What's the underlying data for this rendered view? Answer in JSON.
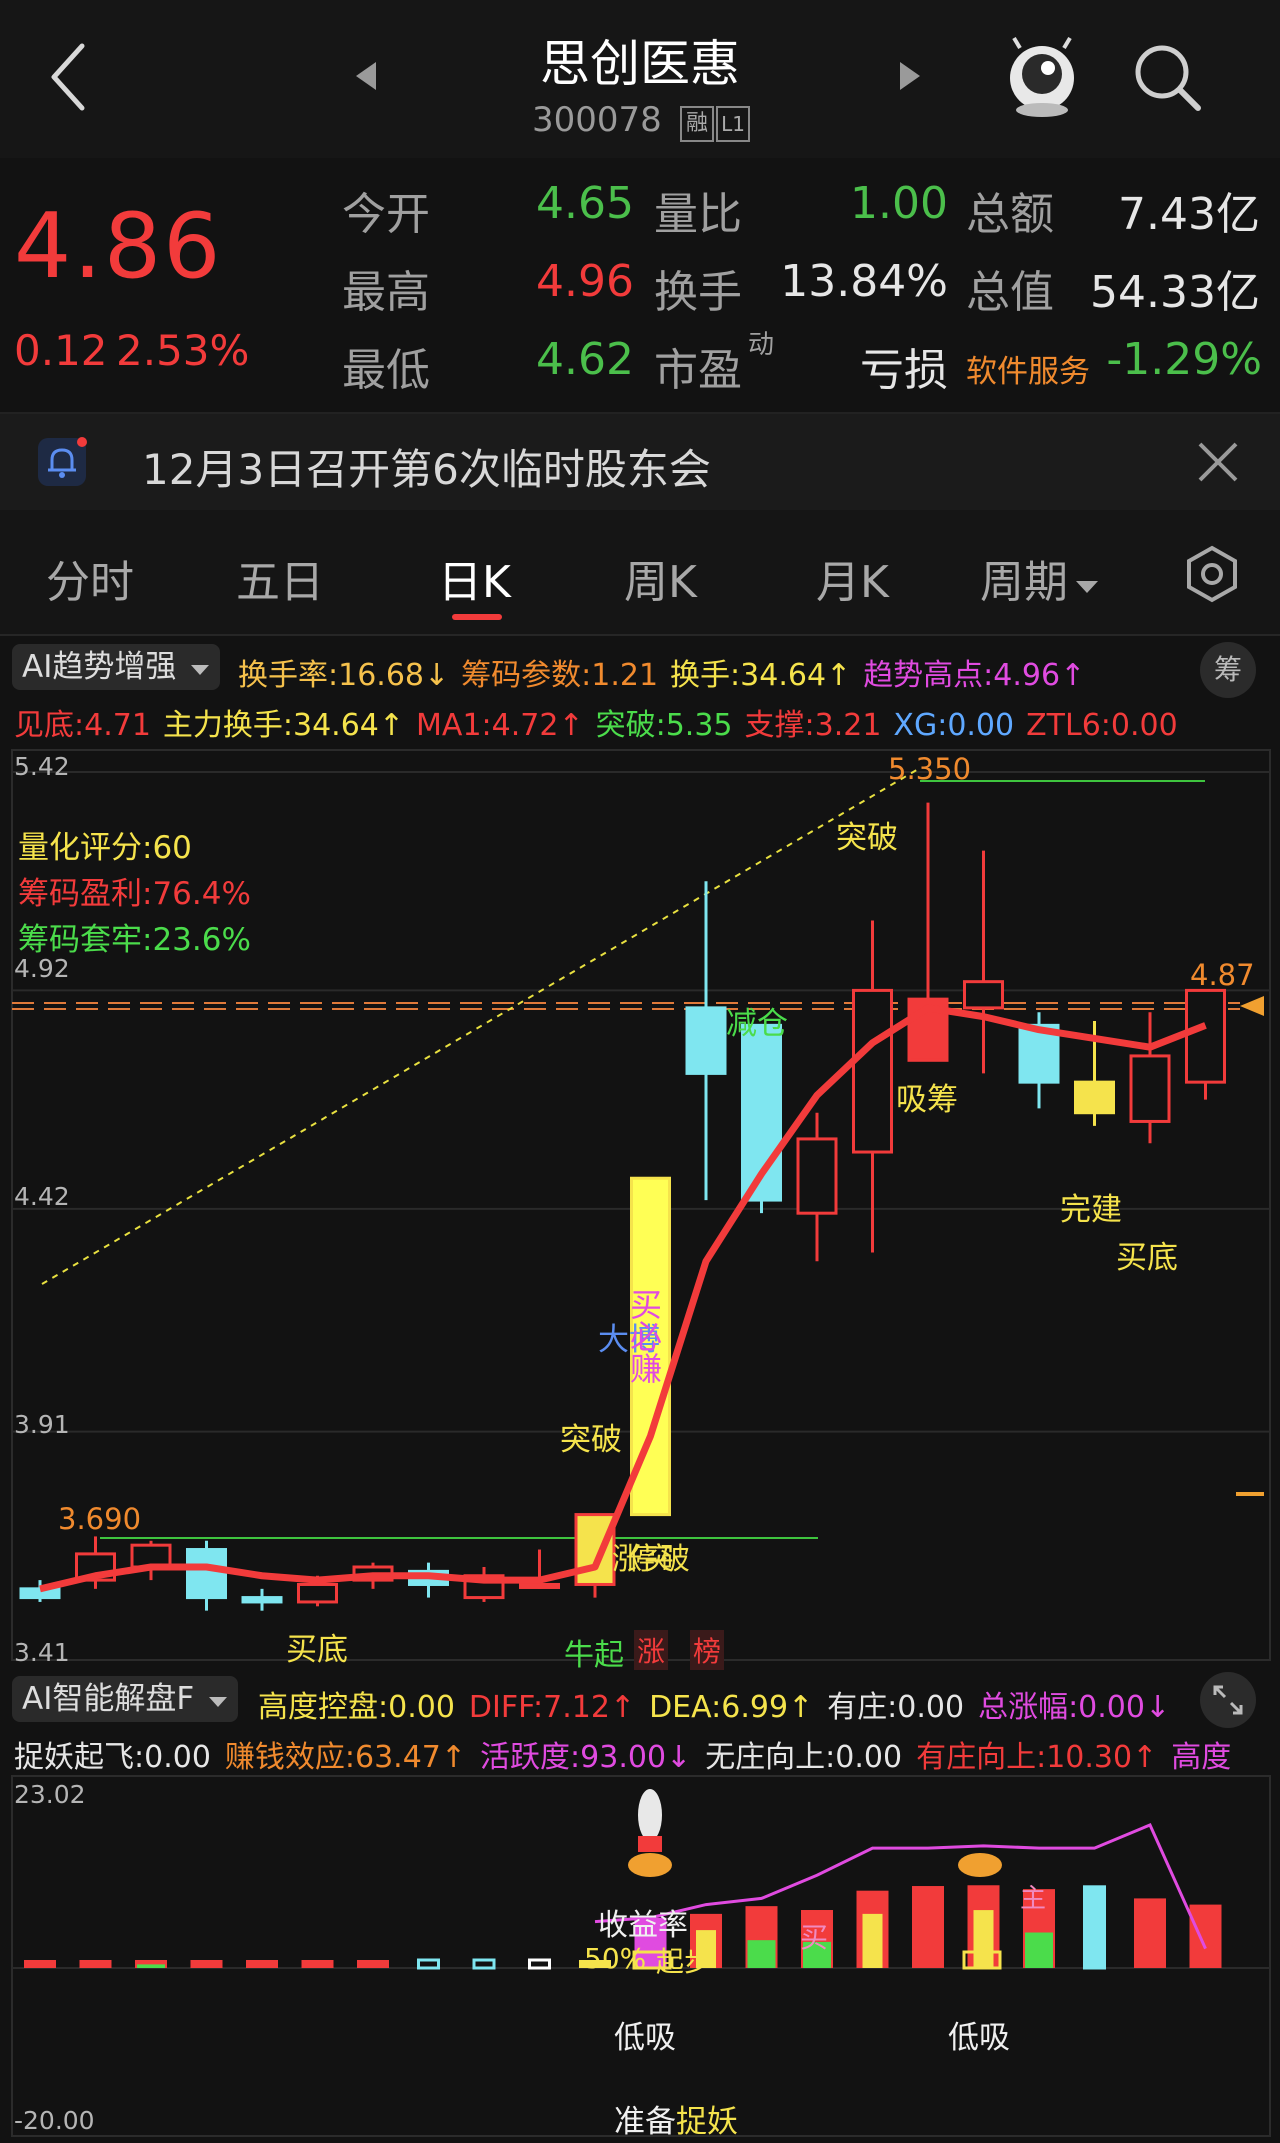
{
  "header": {
    "title": "思创医惠",
    "code": "300078",
    "badge_rong": "融",
    "badge_level": "L1"
  },
  "quote": {
    "price": "4.86",
    "change": "0.12",
    "change_pct": "2.53%",
    "open_label": "今开",
    "open": "4.65",
    "high_label": "最高",
    "high": "4.96",
    "low_label": "最低",
    "low": "4.62",
    "vol_ratio_label": "量比",
    "vol_ratio": "1.00",
    "turnover_label": "换手",
    "turnover": "13.84%",
    "pe_label": "市盈",
    "pe_sup": "动",
    "pe": "亏损",
    "amount_label": "总额",
    "amount": "7.43亿",
    "mcap_label": "总值",
    "mcap": "54.33亿",
    "sector_label": "软件服务",
    "sector_change": "-1.29%"
  },
  "notice": {
    "text": "12月3日召开第6次临时股东会"
  },
  "tabs": [
    "分时",
    "五日",
    "日K",
    "周K",
    "月K",
    "周期"
  ],
  "main_indicator": {
    "name": "AI趋势增强",
    "row1": [
      {
        "text": "换手率:16.68↓",
        "color": "#f5c14c"
      },
      {
        "text": "筹码参数:1.21",
        "color": "#f08a2e"
      },
      {
        "text": "换手:34.64↑",
        "color": "#f5e34c"
      },
      {
        "text": "趋势高点:4.96↑",
        "color": "#e04be0"
      }
    ],
    "row2": [
      {
        "text": "见底:4.71",
        "color": "#f23b3b"
      },
      {
        "text": "主力换手:34.64↑",
        "color": "#f5e34c"
      },
      {
        "text": "MA1:4.72↑",
        "color": "#f23b3b"
      },
      {
        "text": "突破:5.35",
        "color": "#4bdc4b"
      },
      {
        "text": "支撑:3.21",
        "color": "#f23b3b"
      },
      {
        "text": "XG:0.00",
        "color": "#5fa8ff"
      },
      {
        "text": "ZTL6:0.00",
        "color": "#f23b3b"
      }
    ],
    "chip_button": "筹"
  },
  "kchart": {
    "y_ticks": [
      "5.42",
      "4.92",
      "4.42",
      "3.91",
      "3.41"
    ],
    "score": "量化评分:60",
    "profit": "筹码盈利:76.4%",
    "trapped": "筹码套牢:23.6%",
    "high_label": "5.350",
    "low_label": "3.690",
    "last_label": "4.87",
    "annotations": {
      "tupo_top": "突破",
      "jiancang": "减仓",
      "xichou": "吸筹",
      "wanjian": "完建",
      "maidi_right": "买底",
      "maidi_left": "买底",
      "dabo": "大博",
      "buy1": "买",
      "buy2": "必",
      "buy3": "赚",
      "tupo_left": "突破",
      "overlap": "涨停突破",
      "niuqi": "牛起",
      "zhang": "涨",
      "bang": "榜"
    }
  },
  "sub_indicator": {
    "name": "AI智能解盘F",
    "row1": [
      {
        "text": "高度控盘:0.00",
        "color": "#f5e34c"
      },
      {
        "text": "DIFF:7.12↑",
        "color": "#f23b3b"
      },
      {
        "text": "DEA:6.99↑",
        "color": "#f5e34c"
      },
      {
        "text": "有庄:0.00",
        "color": "#e6e6e6"
      },
      {
        "text": "总涨幅:0.00↓",
        "color": "#e04be0"
      }
    ],
    "row2": [
      {
        "text": "捉妖起飞:0.00",
        "color": "#e6e6e6"
      },
      {
        "text": "赚钱效应:63.47↑",
        "color": "#f08a2e"
      },
      {
        "text": "活跃度:93.00↓",
        "color": "#e04be0"
      },
      {
        "text": "无庄向上:0.00",
        "color": "#e6e6e6"
      },
      {
        "text": "有庄向上:10.30↑",
        "color": "#f23b3b"
      },
      {
        "text": "高度",
        "color": "#e04be0"
      }
    ],
    "y_max": "23.02",
    "y_min": "-20.00",
    "labels": {
      "shouyi": "收益率",
      "pct": "50%",
      "qibu": "起步",
      "dixi1": "低吸",
      "dixi2": "低吸",
      "zhunbei": "准备",
      "zhuoyao": "捉妖",
      "mai": "买",
      "zhu": "主"
    }
  },
  "chart_data": {
    "type": "candlestick",
    "price_axis": {
      "min": 3.41,
      "max": 5.42
    },
    "candles": [
      {
        "o": 3.55,
        "h": 3.57,
        "l": 3.52,
        "c": 3.53
      },
      {
        "o": 3.57,
        "h": 3.67,
        "l": 3.55,
        "c": 3.63
      },
      {
        "o": 3.6,
        "h": 3.66,
        "l": 3.57,
        "c": 3.65
      },
      {
        "o": 3.64,
        "h": 3.66,
        "l": 3.5,
        "c": 3.53
      },
      {
        "o": 3.53,
        "h": 3.55,
        "l": 3.5,
        "c": 3.52
      },
      {
        "o": 3.52,
        "h": 3.58,
        "l": 3.51,
        "c": 3.56
      },
      {
        "o": 3.57,
        "h": 3.61,
        "l": 3.55,
        "c": 3.6
      },
      {
        "o": 3.59,
        "h": 3.61,
        "l": 3.53,
        "c": 3.56
      },
      {
        "o": 3.53,
        "h": 3.6,
        "l": 3.52,
        "c": 3.58
      },
      {
        "o": 3.56,
        "h": 3.64,
        "l": 3.55,
        "c": 3.56
      },
      {
        "o": 3.56,
        "h": 3.72,
        "l": 3.53,
        "c": 3.72
      },
      {
        "o": 3.72,
        "h": 4.49,
        "l": 3.72,
        "c": 4.49
      },
      {
        "o": 4.88,
        "h": 5.17,
        "l": 4.44,
        "c": 4.73
      },
      {
        "o": 4.84,
        "h": 4.84,
        "l": 4.41,
        "c": 4.44
      },
      {
        "o": 4.41,
        "h": 4.64,
        "l": 4.3,
        "c": 4.58
      },
      {
        "o": 4.55,
        "h": 5.08,
        "l": 4.32,
        "c": 4.92
      },
      {
        "o": 4.76,
        "h": 5.35,
        "l": 4.76,
        "c": 4.9
      },
      {
        "o": 4.88,
        "h": 5.24,
        "l": 4.73,
        "c": 4.94
      },
      {
        "o": 4.84,
        "h": 4.87,
        "l": 4.65,
        "c": 4.71
      },
      {
        "o": 4.71,
        "h": 4.85,
        "l": 4.61,
        "c": 4.64
      },
      {
        "o": 4.62,
        "h": 4.87,
        "l": 4.57,
        "c": 4.77
      },
      {
        "o": 4.71,
        "h": 4.92,
        "l": 4.67,
        "c": 4.92
      }
    ],
    "ma_line": [
      3.55,
      3.58,
      3.6,
      3.6,
      3.58,
      3.57,
      3.58,
      3.58,
      3.57,
      3.57,
      3.6,
      3.9,
      4.3,
      4.5,
      4.68,
      4.8,
      4.88,
      4.86,
      4.83,
      4.81,
      4.79,
      4.84
    ],
    "sub_bars": [
      {
        "v": 0.5,
        "type": "red"
      },
      {
        "v": 0.6,
        "type": "red"
      },
      {
        "v": 0.8,
        "type": "redgreen"
      },
      {
        "v": 0.6,
        "type": "red"
      },
      {
        "v": 0.5,
        "type": "red"
      },
      {
        "v": 0.6,
        "type": "red"
      },
      {
        "v": 0.5,
        "type": "red"
      },
      {
        "v": 0.5,
        "type": "cyan"
      },
      {
        "v": 0.5,
        "type": "cyan"
      },
      {
        "v": 0.3,
        "type": "white"
      },
      {
        "v": 0.4,
        "type": "yellow"
      },
      {
        "v": 6.5,
        "type": "magenta"
      },
      {
        "v": 7.0,
        "type": "redyellow"
      },
      {
        "v": 8.0,
        "type": "redgreen"
      },
      {
        "v": 7.5,
        "type": "redgreen"
      },
      {
        "v": 10.0,
        "type": "redyellow"
      },
      {
        "v": 10.6,
        "type": "red"
      },
      {
        "v": 10.7,
        "type": "redyellow"
      },
      {
        "v": 10.2,
        "type": "redgreen"
      },
      {
        "v": 10.5,
        "type": "cyan"
      },
      {
        "v": 9.0,
        "type": "red"
      },
      {
        "v": 8.2,
        "type": "red"
      }
    ]
  }
}
